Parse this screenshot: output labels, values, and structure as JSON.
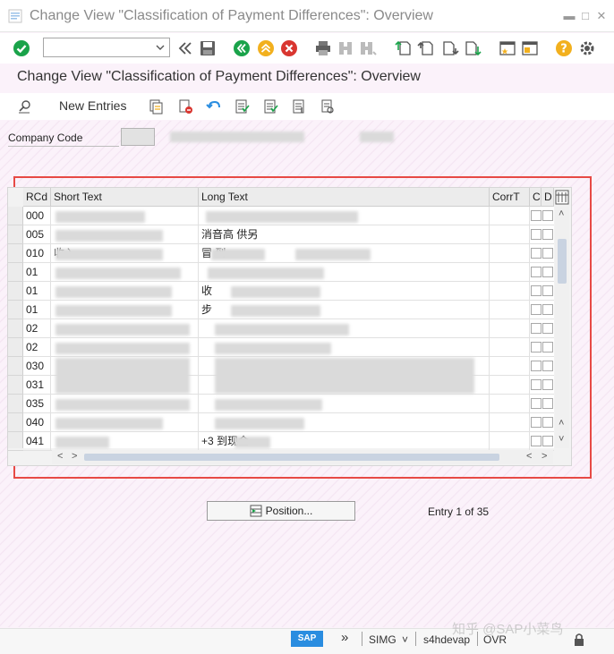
{
  "window": {
    "title": "Change View \"Classification of Payment Differences\": Overview",
    "controls": [
      "minimize-icon",
      "maximize-icon",
      "close-icon"
    ]
  },
  "toolbar": {
    "command_value": "",
    "icons": [
      "enter-check-icon",
      "back-icon",
      "save-icon",
      "back-green-icon",
      "exit-icon",
      "cancel-icon",
      "print-icon",
      "find-icon",
      "find-next-icon",
      "first-page-icon",
      "previous-page-icon",
      "next-page-icon",
      "last-page-icon",
      "create-session-icon",
      "shortcut-icon",
      "help-icon",
      "settings-gear-icon"
    ]
  },
  "screen": {
    "title": "Change View \"Classification of Payment Differences\": Overview",
    "new_entries_label": "New Entries"
  },
  "company_code": {
    "label": "Company Code",
    "value": ""
  },
  "table": {
    "columns": [
      "RCd",
      "Short Text",
      "Long Text",
      "CorrT",
      "C",
      "D"
    ],
    "rows": [
      {
        "code": "000",
        "short": "",
        "long": ""
      },
      {
        "code": "005",
        "short": "",
        "long": "消音高   供另   "
      },
      {
        "code": "010",
        "short": "        收入",
        "long": "          冒   到"
      },
      {
        "code": "01",
        "short": "",
        "long": ""
      },
      {
        "code": "01",
        "short": "",
        "long": "收"
      },
      {
        "code": "01",
        "short": "",
        "long": "步"
      },
      {
        "code": "02",
        "short": "",
        "long": ""
      },
      {
        "code": "02",
        "short": "",
        "long": ""
      },
      {
        "code": "030",
        "short": "",
        "long": ""
      },
      {
        "code": "031",
        "short": "",
        "long": ""
      },
      {
        "code": "035",
        "short": "",
        "long": ""
      },
      {
        "code": "040",
        "short": "",
        "long": ""
      },
      {
        "code": "041",
        "short": "",
        "long": "+3         到现金"
      }
    ]
  },
  "footer": {
    "position_label": "Position...",
    "entry_info": "Entry 1 of 35"
  },
  "status_bar": {
    "system": "SIMG",
    "server": "s4hdevap",
    "mode": "OVR",
    "watermark": "知乎 @SAP小菜鸟",
    "logo_text": "SAP"
  },
  "colors": {
    "highlight_border": "#e74a45",
    "accept_green": "#1aa34a",
    "cancel_red": "#d93630",
    "help_yellow": "#f2b01e",
    "sap_blue": "#2a8de0"
  }
}
